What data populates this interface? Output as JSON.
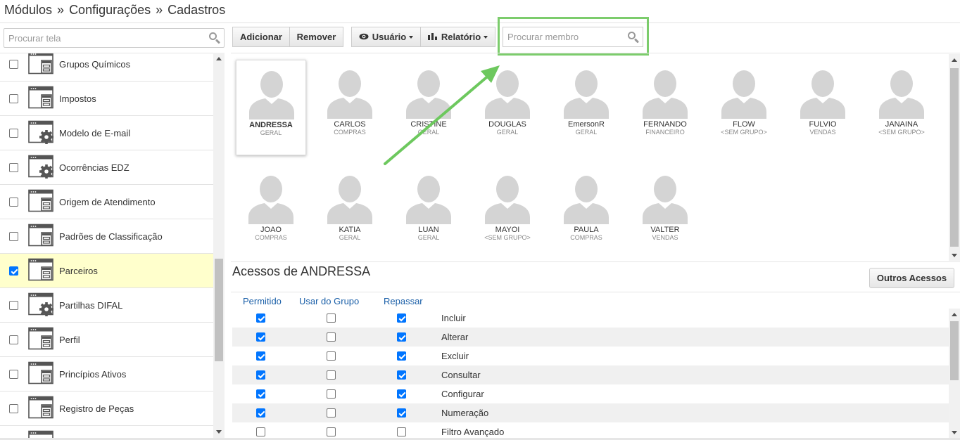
{
  "breadcrumb": {
    "items": [
      "Módulos",
      "Configurações",
      "Cadastros"
    ],
    "separator": "»"
  },
  "sidebar": {
    "search_placeholder": "Procurar tela",
    "items": [
      {
        "label": "Grupos Químicos",
        "icon": "window-form-icon",
        "checked": false,
        "selected": false
      },
      {
        "label": "Impostos",
        "icon": "window-form-icon",
        "checked": false,
        "selected": false
      },
      {
        "label": "Modelo de E-mail",
        "icon": "window-gear-icon",
        "checked": false,
        "selected": false
      },
      {
        "label": "Ocorrências EDZ",
        "icon": "window-gear-icon",
        "checked": false,
        "selected": false
      },
      {
        "label": "Origem de Atendimento",
        "icon": "window-form-icon",
        "checked": false,
        "selected": false
      },
      {
        "label": "Padrões de Classificação",
        "icon": "window-form-icon",
        "checked": false,
        "selected": false
      },
      {
        "label": "Parceiros",
        "icon": "window-form-icon",
        "checked": true,
        "selected": true
      },
      {
        "label": "Partilhas DIFAL",
        "icon": "window-gear-icon",
        "checked": false,
        "selected": false
      },
      {
        "label": "Perfil",
        "icon": "window-form-icon",
        "checked": false,
        "selected": false
      },
      {
        "label": "Princípios Ativos",
        "icon": "window-form-icon",
        "checked": false,
        "selected": false
      },
      {
        "label": "Registro de Peças",
        "icon": "window-form-icon",
        "checked": false,
        "selected": false
      },
      {
        "label": "",
        "icon": "window-form-icon",
        "checked": false,
        "selected": false
      }
    ]
  },
  "toolbar": {
    "add_label": "Adicionar",
    "remove_label": "Remover",
    "user_menu_label": "Usuário",
    "report_menu_label": "Relatório",
    "member_search_placeholder": "Procurar membro"
  },
  "users": [
    {
      "name": "ANDRESSA",
      "group": "GERAL",
      "selected": true
    },
    {
      "name": "CARLOS",
      "group": "COMPRAS",
      "selected": false
    },
    {
      "name": "CRISTINE",
      "group": "GERAL",
      "selected": false
    },
    {
      "name": "DOUGLAS",
      "group": "GERAL",
      "selected": false
    },
    {
      "name": "EmersonR",
      "group": "GERAL",
      "selected": false
    },
    {
      "name": "FERNANDO",
      "group": "FINANCEIRO",
      "selected": false
    },
    {
      "name": "FLOW",
      "group": "<SEM GRUPO>",
      "selected": false
    },
    {
      "name": "FULVIO",
      "group": "VENDAS",
      "selected": false
    },
    {
      "name": "JANAINA",
      "group": "<SEM GRUPO>",
      "selected": false
    },
    {
      "name": "JOAO",
      "group": "COMPRAS",
      "selected": false
    },
    {
      "name": "KATIA",
      "group": "GERAL",
      "selected": false
    },
    {
      "name": "LUAN",
      "group": "GERAL",
      "selected": false
    },
    {
      "name": "MAYOI",
      "group": "<SEM GRUPO>",
      "selected": false
    },
    {
      "name": "PAULA",
      "group": "COMPRAS",
      "selected": false
    },
    {
      "name": "VALTER",
      "group": "VENDAS",
      "selected": false
    }
  ],
  "access": {
    "title": "Acessos de ANDRESSA",
    "other_button_label": "Outros Acessos",
    "columns": [
      "Permitido",
      "Usar do Grupo",
      "Repassar"
    ],
    "rows": [
      {
        "label": "Incluir",
        "permitido": true,
        "usar_grupo": false,
        "repassar": true
      },
      {
        "label": "Alterar",
        "permitido": true,
        "usar_grupo": false,
        "repassar": true
      },
      {
        "label": "Excluir",
        "permitido": true,
        "usar_grupo": false,
        "repassar": true
      },
      {
        "label": "Consultar",
        "permitido": true,
        "usar_grupo": false,
        "repassar": true
      },
      {
        "label": "Configurar",
        "permitido": true,
        "usar_grupo": false,
        "repassar": true
      },
      {
        "label": "Numeração",
        "permitido": true,
        "usar_grupo": false,
        "repassar": true
      },
      {
        "label": "Filtro Avançado",
        "permitido": false,
        "usar_grupo": false,
        "repassar": false
      }
    ]
  },
  "colors": {
    "highlight": "#7ccc6c",
    "checkbox_on": "#0075ff",
    "selected_row": "#ffffcc",
    "header_link": "#1a5fa8"
  }
}
